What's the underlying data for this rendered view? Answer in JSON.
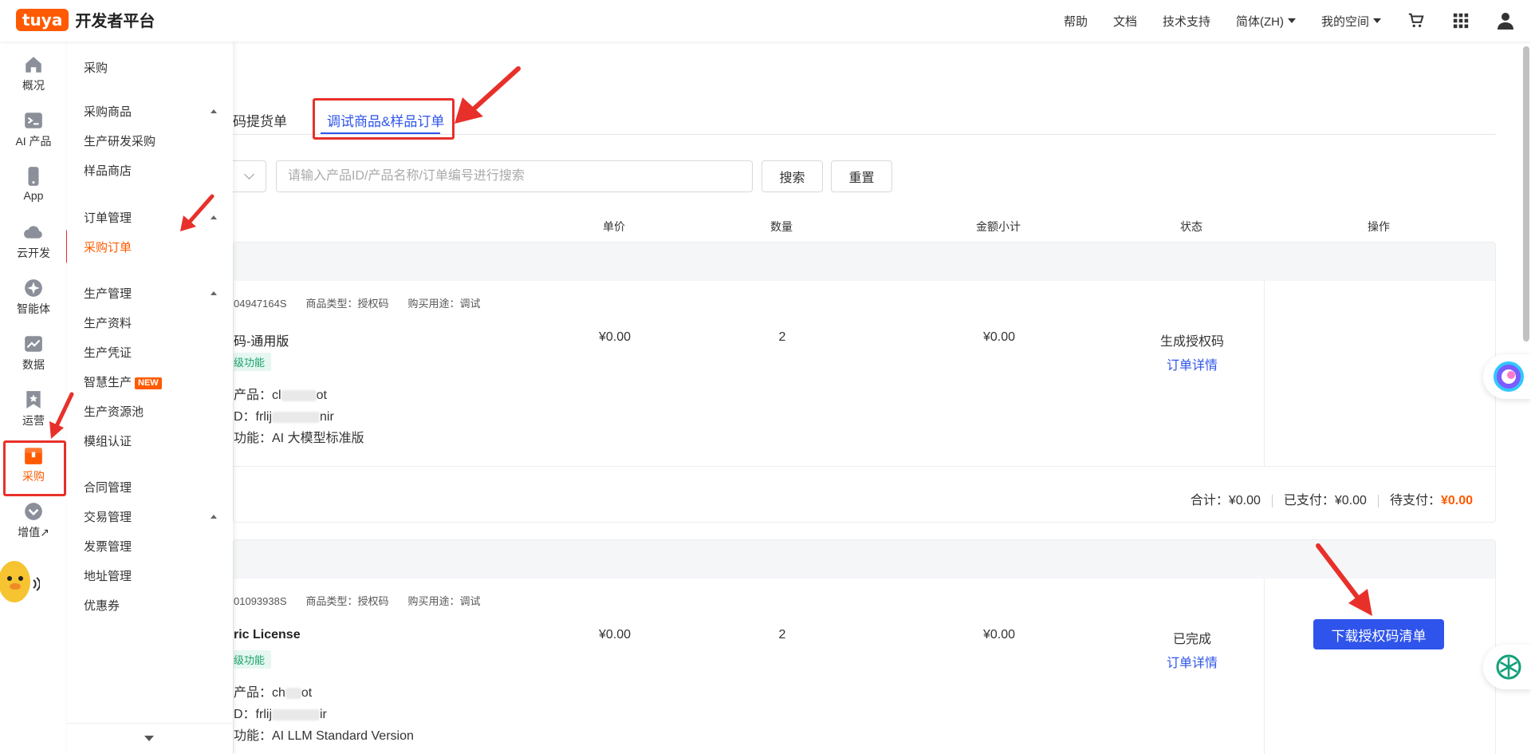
{
  "header": {
    "logo_text": "tuya",
    "platform_name": "开发者平台",
    "nav": [
      "帮助",
      "文档",
      "技术支持",
      "简体(ZH)",
      "我的空间"
    ]
  },
  "iconbar": {
    "items": [
      {
        "label": "概况",
        "icon": "home-icon"
      },
      {
        "label": "AI 产品",
        "icon": "terminal-icon"
      },
      {
        "label": "App",
        "icon": "phone-icon"
      },
      {
        "label": "云开发",
        "icon": "cloud-icon"
      },
      {
        "label": "智能体",
        "icon": "agent-icon"
      },
      {
        "label": "数据",
        "icon": "chart-icon"
      },
      {
        "label": "运营",
        "icon": "star-icon"
      },
      {
        "label": "采购",
        "icon": "box-icon"
      },
      {
        "label": "增值",
        "icon": "chevron-down-circle-icon"
      }
    ],
    "active": "采购",
    "value_added_suffix": "↗"
  },
  "submenu": {
    "title": "采购",
    "groups": [
      {
        "label": "采购商品",
        "items": [
          "生产研发采购",
          "样品商店"
        ]
      },
      {
        "label": "订单管理",
        "items": [
          "采购订单"
        ]
      },
      {
        "label": "生产管理",
        "items": [
          "生产资料",
          "生产凭证",
          "智慧生产",
          "生产资源池",
          "模组认证"
        ]
      },
      {
        "label": "合同管理",
        "items": []
      },
      {
        "label": "交易管理",
        "items": [
          "发票管理",
          "地址管理",
          "优惠券"
        ]
      }
    ],
    "active_item": "采购订单",
    "new_badge": "NEW"
  },
  "main": {
    "tabs": [
      "码提货单",
      "调试商品&样品订单"
    ],
    "active_tab": "调试商品&样品订单",
    "search": {
      "placeholder": "请输入产品ID/产品名称/订单编号进行搜索",
      "search_button": "搜索",
      "reset_button": "重置"
    },
    "columns": [
      "单价",
      "数量",
      "金额小计",
      "状态",
      "操作"
    ],
    "orders": [
      {
        "order_no_fragment": "04947164S",
        "type_label": "商品类型：授权码",
        "purpose_label": "购买用途：调试",
        "product_name": "码-通用版",
        "tag": "级功能",
        "product_line": "产品：cl",
        "product_line_tail": "ot",
        "id_line": "D：frlij",
        "id_line_tail": "nir",
        "feature_line": "功能：AI 大模型标准版",
        "unit_price": "¥0.00",
        "quantity": "2",
        "subtotal": "¥0.00",
        "status": "生成授权码",
        "detail_link": "订单详情",
        "summary": {
          "total": "合计：¥0.00",
          "paid": "已支付：¥0.00",
          "due_label": "待支付：",
          "due_value": "¥0.00"
        }
      },
      {
        "order_no_fragment": "01093938S",
        "type_label": "商品类型：授权码",
        "purpose_label": "购买用途：调试",
        "product_name": "ric License",
        "tag": "级功能",
        "product_line": "产品：ch",
        "product_line_tail": "ot",
        "id_line": "D：frlij",
        "id_line_tail": "ir",
        "feature_line": "功能：AI LLM Standard Version",
        "unit_price": "¥0.00",
        "quantity": "2",
        "subtotal": "¥0.00",
        "status": "已完成",
        "detail_link": "订单详情",
        "action_button": "下载授权码清单"
      }
    ]
  },
  "colors": {
    "brand": "#ff5a00",
    "primary": "#2f54eb",
    "highlight": "#e8302a"
  }
}
